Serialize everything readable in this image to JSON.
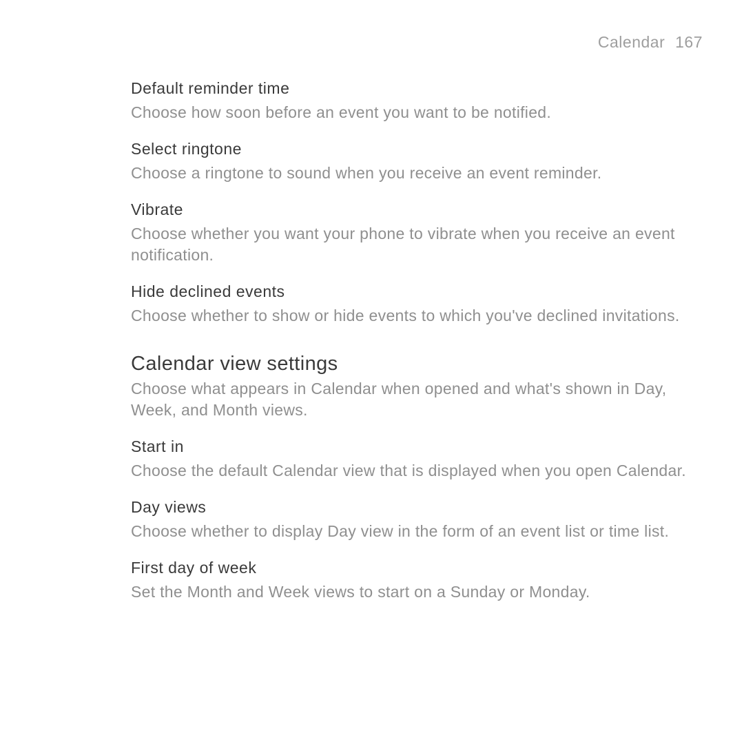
{
  "header": {
    "section": "Calendar",
    "page": "167"
  },
  "items1": [
    {
      "title": "Default reminder time",
      "desc": "Choose how soon before an event you want to be notified."
    },
    {
      "title": "Select ringtone",
      "desc": "Choose a ringtone to sound when you receive an event reminder."
    },
    {
      "title": "Vibrate",
      "desc": "Choose whether you want your phone to vibrate when you receive an event notification."
    },
    {
      "title": "Hide declined events",
      "desc": "Choose whether to show or hide events to which you've declined invitations."
    }
  ],
  "section2": {
    "title": "Calendar view settings",
    "desc": "Choose what appears in Calendar when opened and what's shown in Day, Week, and Month views."
  },
  "items2": [
    {
      "title": "Start in",
      "desc": "Choose the default Calendar view that is displayed when you open Calendar."
    },
    {
      "title": "Day views",
      "desc": "Choose whether to display Day view in the form of an event list or time list."
    },
    {
      "title": "First day of week",
      "desc": "Set the Month and Week views to start on a Sunday or Monday."
    }
  ]
}
